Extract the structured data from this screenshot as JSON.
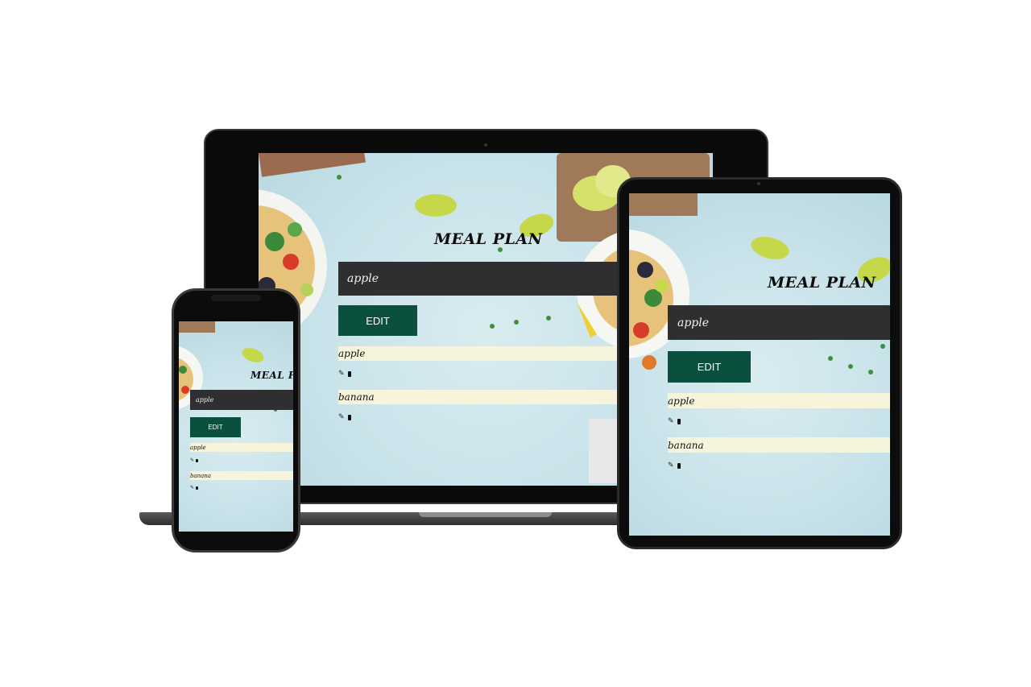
{
  "app": {
    "title": "MEAL PLAN",
    "input_value": "apple",
    "edit_label": "EDIT",
    "items": [
      {
        "label": "apple"
      },
      {
        "label": "banana"
      }
    ],
    "edit_icon": "pencil-icon",
    "delete_icon": "trash-icon"
  },
  "colors": {
    "input_bg": "#2f2f31",
    "button_bg": "#0b4f3f",
    "row_bg": "#f6f5dc",
    "screen_bg": "#c9e3ea"
  }
}
